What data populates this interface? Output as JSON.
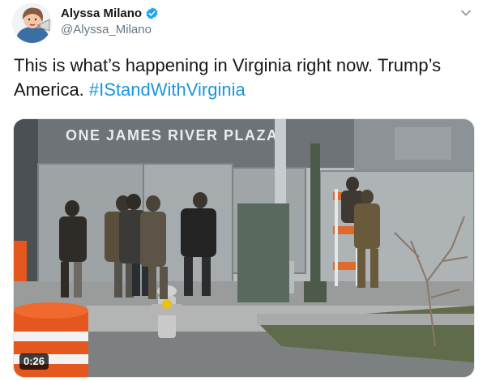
{
  "tweet": {
    "display_name": "Alyssa Milano",
    "handle": "@Alyssa_Milano",
    "verified": true,
    "text": "This is what’s happening in Virginia right now. Trump’s America. ",
    "hashtag": "#IStandWithVirginia"
  },
  "media": {
    "building_sign": "ONE JAMES RIVER PLAZA",
    "duration": "0:26"
  },
  "icons": {
    "verified": "verified-badge-icon",
    "menu": "chevron-down-icon"
  },
  "colors": {
    "link": "#1b95e0",
    "verified_badge": "#1da1f2",
    "secondary_text": "#657786"
  }
}
